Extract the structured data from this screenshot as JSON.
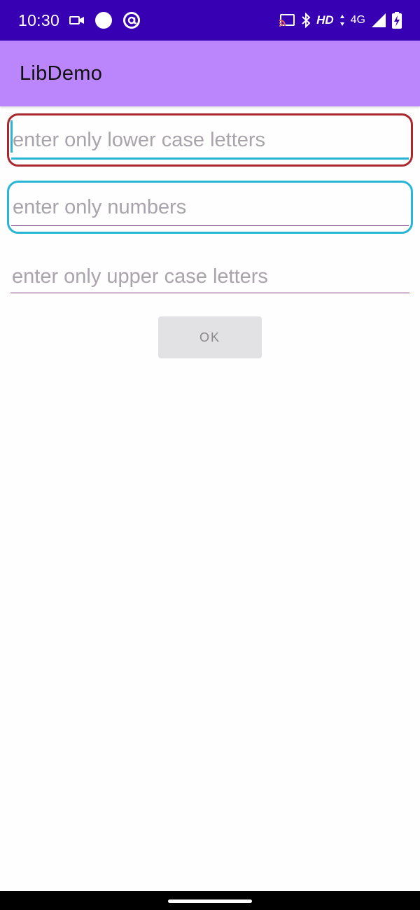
{
  "status_bar": {
    "time": "10:30",
    "hd_label": "HD",
    "network_label": "4G",
    "left_icons": [
      "video-camera-icon",
      "circle-icon",
      "at-sign-icon"
    ],
    "right_icons": [
      "cast-icon",
      "bluetooth-icon",
      "data-arrows-icon",
      "signal-icon",
      "battery-charging-icon"
    ],
    "colors": {
      "background": "#3700b3",
      "foreground": "#ffffff"
    }
  },
  "app_bar": {
    "title": "LibDemo",
    "background": "#bb86fc"
  },
  "form": {
    "fields": [
      {
        "placeholder": "enter only lower case letters",
        "value": "",
        "border_color": "#a8282e",
        "focused": true
      },
      {
        "placeholder": "enter only numbers",
        "value": "",
        "border_color": "#26b5d4",
        "focused": false
      },
      {
        "placeholder": "enter only upper case letters",
        "value": "",
        "border_color": "",
        "focused": false
      }
    ],
    "ok_button": {
      "label": "OK",
      "enabled": false
    }
  },
  "nav_bar": {
    "icon": "gesture-handle"
  }
}
